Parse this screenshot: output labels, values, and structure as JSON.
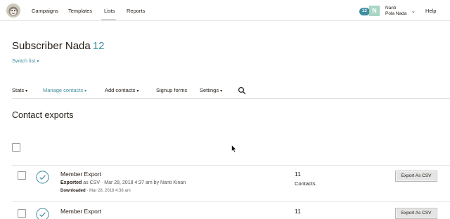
{
  "nav": {
    "links": [
      {
        "label": "Campaigns"
      },
      {
        "label": "Templates"
      },
      {
        "label": "Lists"
      },
      {
        "label": "Reports"
      }
    ],
    "notification_count": "13",
    "avatar_initial": "N",
    "user_name": "Nanti",
    "user_org": "Pola Nada",
    "help": "Help"
  },
  "header": {
    "list_name": "Subscriber Nada",
    "list_count": "12",
    "switch_list": "Switch list"
  },
  "subnav": {
    "items": [
      {
        "label": "Stats"
      },
      {
        "label": "Manage contacts"
      },
      {
        "label": "Add contacts"
      },
      {
        "label": "Signup forms"
      },
      {
        "label": "Settings"
      }
    ]
  },
  "section_title": "Contact exports",
  "exports": [
    {
      "name": "Member Export",
      "status": "Exported",
      "detail": " as CSV · Mar 28, 2018 4:37 am by Nanti Kinan",
      "downloaded": "Downloaded",
      "downloaded_detail": " · Mar 28, 2018 4:38 am",
      "count": "11",
      "unit": "Contacts",
      "button": "Export As CSV"
    },
    {
      "name": "Member Export",
      "count": "11",
      "button": "Export As CSV"
    }
  ],
  "colors": {
    "accent": "#3f8ea0",
    "avatar_bg": "#a8d5c4",
    "text": "#241c15"
  }
}
